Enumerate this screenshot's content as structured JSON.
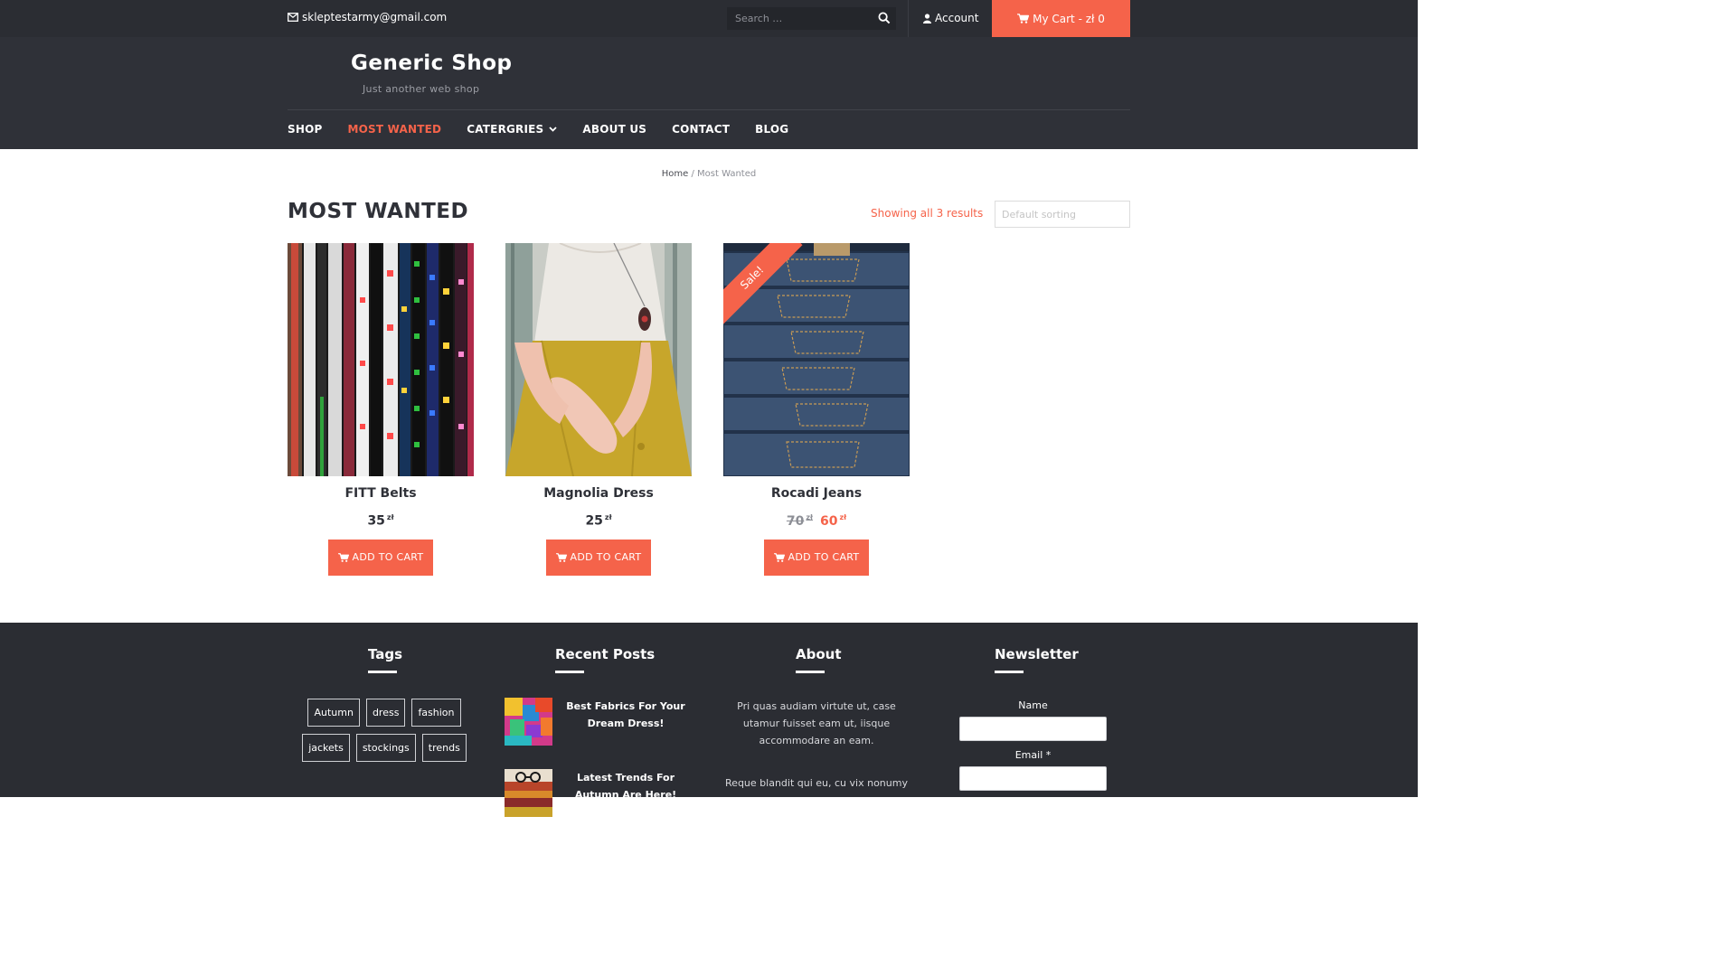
{
  "topbar": {
    "email": "skleptestarmy@gmail.com",
    "search_placeholder": "Search …",
    "account_label": "Account",
    "cart_label": "My Cart - zł 0"
  },
  "header": {
    "site_title": "Generic Shop",
    "tagline": "Just another web shop"
  },
  "nav": {
    "items": [
      {
        "label": "SHOP"
      },
      {
        "label": "MOST WANTED",
        "active": true
      },
      {
        "label": "CATERGRIES",
        "dropdown": true
      },
      {
        "label": "ABOUT US"
      },
      {
        "label": "CONTACT"
      },
      {
        "label": "BLOG"
      }
    ]
  },
  "breadcrumb": {
    "home": "Home",
    "separator": " / ",
    "current": "Most Wanted"
  },
  "main": {
    "title": "MOST WANTED",
    "result_count": "Showing all 3 results",
    "sorting": "Default sorting"
  },
  "products": [
    {
      "name": "FITT Belts",
      "price": "35",
      "currency": "zł",
      "add_label": "ADD TO CART"
    },
    {
      "name": "Magnolia Dress",
      "price": "25",
      "currency": "zł",
      "add_label": "ADD TO CART"
    },
    {
      "name": "Rocadi Jeans",
      "old_price": "70",
      "price": "60",
      "currency": "zł",
      "sale_label": "Sale!",
      "add_label": "ADD TO CART"
    }
  ],
  "footer": {
    "tags_title": "Tags",
    "tags": [
      "Autumn",
      "dress",
      "fashion",
      "jackets",
      "stockings",
      "trends"
    ],
    "posts_title": "Recent Posts",
    "posts": [
      {
        "title": "Best Fabrics For Your Dream Dress!"
      },
      {
        "title": "Latest Trends For Autumn Are Here!"
      }
    ],
    "about_title": "About",
    "about_p1": "Pri quas audiam virtute ut, case utamur fuisset eam ut, iisque accommodare an eam.",
    "about_p2": "Reque blandit qui eu, cu vix nonumy",
    "newsletter_title": "Newsletter",
    "name_label": "Name",
    "email_label": "Email *"
  },
  "colors": {
    "accent": "#f5634a",
    "topbar_bg": "#2b2d33",
    "header_bg": "#2f3138"
  }
}
